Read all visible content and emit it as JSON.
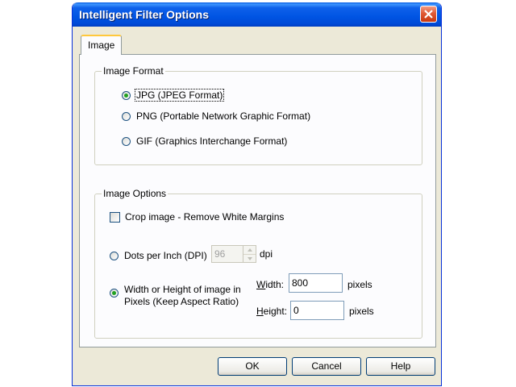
{
  "window": {
    "title": "Intelligent Filter Options"
  },
  "tabs": [
    {
      "label": "Image",
      "selected": true
    }
  ],
  "image_format": {
    "title": "Image Format",
    "options": [
      {
        "label": "JPG (JPEG Format)",
        "selected": true
      },
      {
        "label": "PNG (Portable Network Graphic Format)",
        "selected": false
      },
      {
        "label": "GIF (Graphics Interchange Format)",
        "selected": false
      }
    ]
  },
  "image_options": {
    "title": "Image Options",
    "crop": {
      "label": "Crop image - Remove White Margins",
      "checked": false
    },
    "dpi": {
      "label": "Dots per Inch (DPI)",
      "value": "96",
      "unit": "dpi",
      "selected": false
    },
    "pixels": {
      "label_line1": "Width or Height of image in",
      "label_line2": "Pixels (Keep Aspect Ratio)",
      "selected": true,
      "width_label_mnemonic": "W",
      "width_label_rest": "idth:",
      "width_value": "800",
      "width_unit": "pixels",
      "height_label_mnemonic": "H",
      "height_label_rest": "eight:",
      "height_value": "0",
      "height_unit": "pixels"
    }
  },
  "buttons": {
    "ok": "OK",
    "cancel": "Cancel",
    "help": "Help"
  },
  "colors": {
    "title_bar": "#0054e3",
    "dialog_face": "#ece9d8",
    "close_button": "#e05a36"
  },
  "icons": {
    "close": "close-x-icon",
    "spin_up": "spin-up-arrow-icon",
    "spin_down": "spin-down-arrow-icon"
  }
}
